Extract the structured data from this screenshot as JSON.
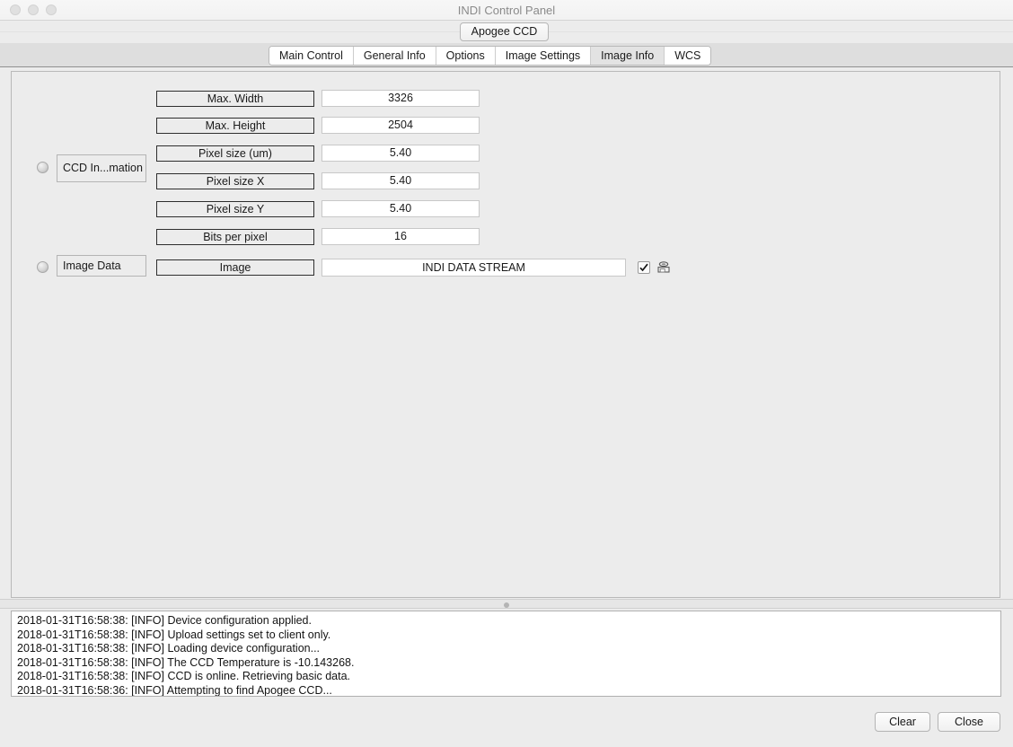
{
  "window": {
    "title": "INDI Control Panel",
    "traffic_lights": [
      "close-button",
      "minimize-button",
      "maximize-button"
    ]
  },
  "device_tabs": [
    {
      "label": "Apogee CCD",
      "active": true
    }
  ],
  "main_tabs": [
    {
      "label": "Main Control",
      "active": false
    },
    {
      "label": "General Info",
      "active": false
    },
    {
      "label": "Options",
      "active": false
    },
    {
      "label": "Image Settings",
      "active": false
    },
    {
      "label": "Image Info",
      "active": true
    },
    {
      "label": "WCS",
      "active": false
    }
  ],
  "groups": [
    {
      "name": "CCD In...mation",
      "led": "idle-led",
      "rows": [
        {
          "label": "Max. Width",
          "value": "3326"
        },
        {
          "label": "Max. Height",
          "value": "2504"
        },
        {
          "label": "Pixel size (um)",
          "value": "5.40"
        },
        {
          "label": "Pixel size X",
          "value": "5.40"
        },
        {
          "label": "Pixel size Y",
          "value": "5.40"
        },
        {
          "label": "Bits per pixel",
          "value": "16"
        }
      ]
    },
    {
      "name": "Image Data",
      "led": "idle-led",
      "rows": [
        {
          "label": "Image",
          "value": "INDI DATA STREAM",
          "checkbox": true,
          "checked": true,
          "save_icon": "save-blob-icon"
        }
      ]
    }
  ],
  "log": {
    "lines": [
      "2018-01-31T16:58:38: [INFO] Device configuration applied.",
      "2018-01-31T16:58:38: [INFO] Upload settings set to client only.",
      "2018-01-31T16:58:38: [INFO] Loading device configuration...",
      "2018-01-31T16:58:38: [INFO] The CCD Temperature is -10.143268.",
      "2018-01-31T16:58:38: [INFO] CCD is online. Retrieving basic data.",
      "2018-01-31T16:58:36: [INFO] Attempting to find Apogee CCD..."
    ]
  },
  "footer": {
    "clear_label": "Clear",
    "close_label": "Close"
  },
  "colors": {
    "window_bg": "#ececec",
    "titlebar": "#f5f5f5",
    "panel_border": "#b9b9b9",
    "field_bg": "#ffffff",
    "label_border": "#2e2e2e",
    "tab_active_bg": "#e3e3e3",
    "text": "#1a1a1a",
    "title_text": "#8a8a8a"
  }
}
